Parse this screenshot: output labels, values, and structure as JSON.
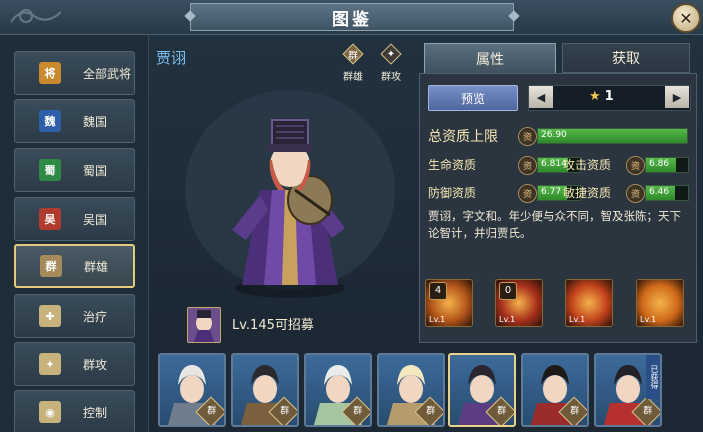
{
  "window": {
    "title": "图鉴",
    "close_glyph": "✕"
  },
  "sidebar": {
    "items": [
      {
        "label": "全部武将",
        "icon": "all-generals-icon",
        "glyph": "将",
        "color": "#c98a2e"
      },
      {
        "label": "魏国",
        "icon": "wei-icon",
        "glyph": "魏",
        "color": "#2f5fa8"
      },
      {
        "label": "蜀国",
        "icon": "shu-icon",
        "glyph": "蜀",
        "color": "#2f8a46"
      },
      {
        "label": "吴国",
        "icon": "wu-icon",
        "glyph": "吴",
        "color": "#b13a2e"
      },
      {
        "label": "群雄",
        "icon": "qunxiong-icon",
        "glyph": "群",
        "color": "#a58a5a"
      },
      {
        "label": "治疗",
        "icon": "heal-icon",
        "glyph": "✚",
        "color": "#c8b27c"
      },
      {
        "label": "群攻",
        "icon": "aoe-icon",
        "glyph": "✦",
        "color": "#c8b27c"
      },
      {
        "label": "控制",
        "icon": "control-icon",
        "glyph": "◉",
        "color": "#c8b27c"
      }
    ],
    "active_index": 4
  },
  "hero": {
    "name": "贾诩",
    "tags": [
      {
        "label": "群雄",
        "glyph": "群"
      },
      {
        "label": "群攻",
        "glyph": "✦"
      }
    ],
    "recruit_text": "Lv.145可招募"
  },
  "tabs": {
    "attributes": "属性",
    "obtain": "获取"
  },
  "attributes": {
    "preview_label": "预览",
    "star_value": "1",
    "star_glyph": "★",
    "left_arrow": "◀",
    "right_arrow": "▶",
    "total_label": "总资质上限",
    "total_value": "26.90",
    "total_fill": 1.0,
    "stats": [
      {
        "label": "生命资质",
        "value": "6.814",
        "fill": 0.72
      },
      {
        "label": "攻击资质",
        "value": "6.86",
        "fill": 0.72
      },
      {
        "label": "防御资质",
        "value": "6.77",
        "fill": 0.7
      },
      {
        "label": "敏捷资质",
        "value": "6.46",
        "fill": 0.68
      }
    ],
    "coin_glyph": "资",
    "bio": "贾诩，字文和。年少便与众不同，智及张陈；天下论智计，并归贾氏。"
  },
  "skills": [
    {
      "num": "4",
      "level": "Lv.1",
      "color": "#b4561a"
    },
    {
      "num": "0",
      "level": "Lv.1",
      "color": "#a8301c"
    },
    {
      "num": "",
      "level": "Lv.1",
      "color": "#c2421c"
    },
    {
      "num": "",
      "level": "Lv.1",
      "color": "#d06a1a"
    }
  ],
  "roster": {
    "faction_glyph": "群",
    "owned_label": "已获得",
    "selected_index": 4,
    "cards": [
      {
        "hair": "#e8e6e2",
        "robe": "#6f7c8c"
      },
      {
        "hair": "#2b2a2e",
        "robe": "#7c5f3c"
      },
      {
        "hair": "#e9ecea",
        "robe": "#a6c6a2"
      },
      {
        "hair": "#f1e8c0",
        "robe": "#b69c6c"
      },
      {
        "hair": "#2a2630",
        "robe": "#5c3d82"
      },
      {
        "hair": "#1e1a1a",
        "robe": "#9c2c2c"
      },
      {
        "hair": "#222028",
        "robe": "#b73030"
      }
    ]
  }
}
